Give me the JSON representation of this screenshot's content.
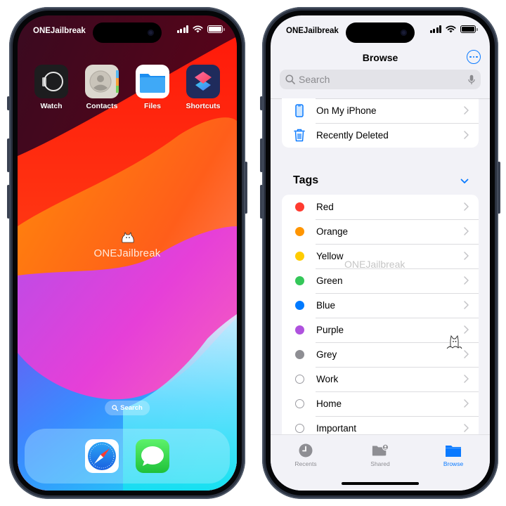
{
  "left_phone": {
    "status": {
      "carrier": "ONEJailbreak",
      "battery_percent": 100
    },
    "apps": [
      {
        "name": "watch",
        "label": "Watch"
      },
      {
        "name": "contacts",
        "label": "Contacts"
      },
      {
        "name": "files",
        "label": "Files"
      },
      {
        "name": "shortcuts",
        "label": "Shortcuts"
      }
    ],
    "watermark": "ONEJailbreak",
    "search_pill": "Search",
    "dock": [
      {
        "name": "safari",
        "label": "Safari"
      },
      {
        "name": "messages",
        "label": "Messages"
      }
    ]
  },
  "right_phone": {
    "status": {
      "carrier": "ONEJailbreak",
      "battery_percent": 100
    },
    "nav": {
      "title": "Browse",
      "more_icon": "ellipsis-circle-icon"
    },
    "search": {
      "placeholder": "Search",
      "mic_icon": "microphone-icon"
    },
    "locations": [
      {
        "label": "On My iPhone",
        "icon": "iphone-icon"
      },
      {
        "label": "Recently Deleted",
        "icon": "trash-icon"
      }
    ],
    "tags_header": "Tags",
    "tags": [
      {
        "label": "Red",
        "color": "#ff3b30"
      },
      {
        "label": "Orange",
        "color": "#ff9500"
      },
      {
        "label": "Yellow",
        "color": "#ffcc00"
      },
      {
        "label": "Green",
        "color": "#34c759"
      },
      {
        "label": "Blue",
        "color": "#007aff"
      },
      {
        "label": "Purple",
        "color": "#af52de"
      },
      {
        "label": "Grey",
        "color": "#8e8e93"
      },
      {
        "label": "Work",
        "color": null
      },
      {
        "label": "Home",
        "color": null
      },
      {
        "label": "Important",
        "color": null
      }
    ],
    "watermark": "ONEJailbreak",
    "tabbar": [
      {
        "label": "Recents",
        "icon": "clock-icon",
        "active": false
      },
      {
        "label": "Shared",
        "icon": "shared-folder-icon",
        "active": false
      },
      {
        "label": "Browse",
        "icon": "folder-icon",
        "active": true
      }
    ],
    "accent": "#0a7aff"
  }
}
